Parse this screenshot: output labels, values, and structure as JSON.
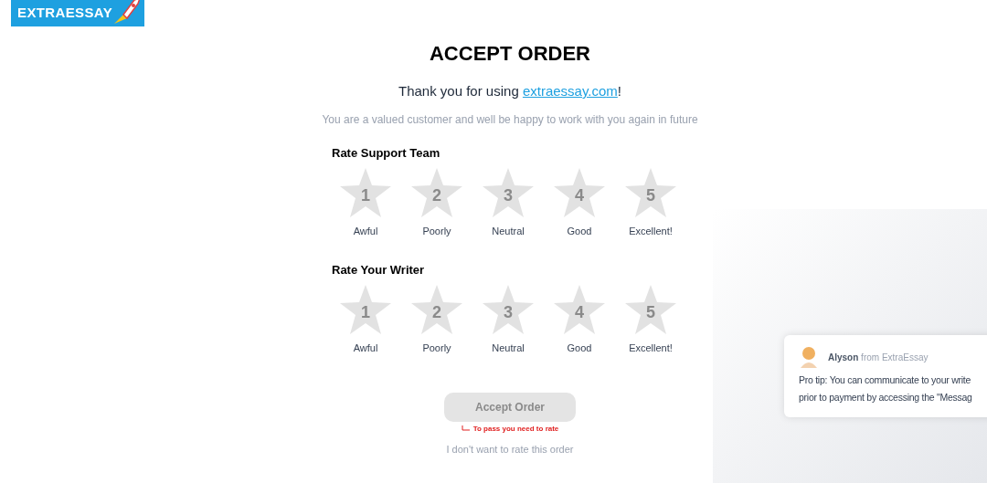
{
  "logo": {
    "text": "EXTRAESSAY"
  },
  "title": "ACCEPT ORDER",
  "thanks": {
    "before": "Thank you for using ",
    "link": "extraessay.com",
    "after": "!"
  },
  "subtitle": "You are a valued customer and well be happy to work with you again in future",
  "ratings": [
    {
      "title": "Rate Support Team",
      "stars": 0,
      "options": [
        {
          "number": "1",
          "label": "Awful"
        },
        {
          "number": "2",
          "label": "Poorly"
        },
        {
          "number": "3",
          "label": "Neutral"
        },
        {
          "number": "4",
          "label": "Good"
        },
        {
          "number": "5",
          "label": "Excellent!"
        }
      ]
    },
    {
      "title": "Rate Your Writer",
      "stars": 0,
      "options": [
        {
          "number": "1",
          "label": "Awful"
        },
        {
          "number": "2",
          "label": "Poorly"
        },
        {
          "number": "3",
          "label": "Neutral"
        },
        {
          "number": "4",
          "label": "Good"
        },
        {
          "number": "5",
          "label": "Excellent!"
        }
      ]
    }
  ],
  "accept_button": {
    "label": "Accept Order",
    "disabled": true
  },
  "hint": "To pass you need to rate",
  "skip_link": "I don't want to rate this order",
  "chat": {
    "name": "Alyson",
    "from": "from ExtraEssay",
    "lines": [
      "Pro tip:  You can communicate to your write",
      "prior to payment by accessing the \"Messag"
    ]
  }
}
